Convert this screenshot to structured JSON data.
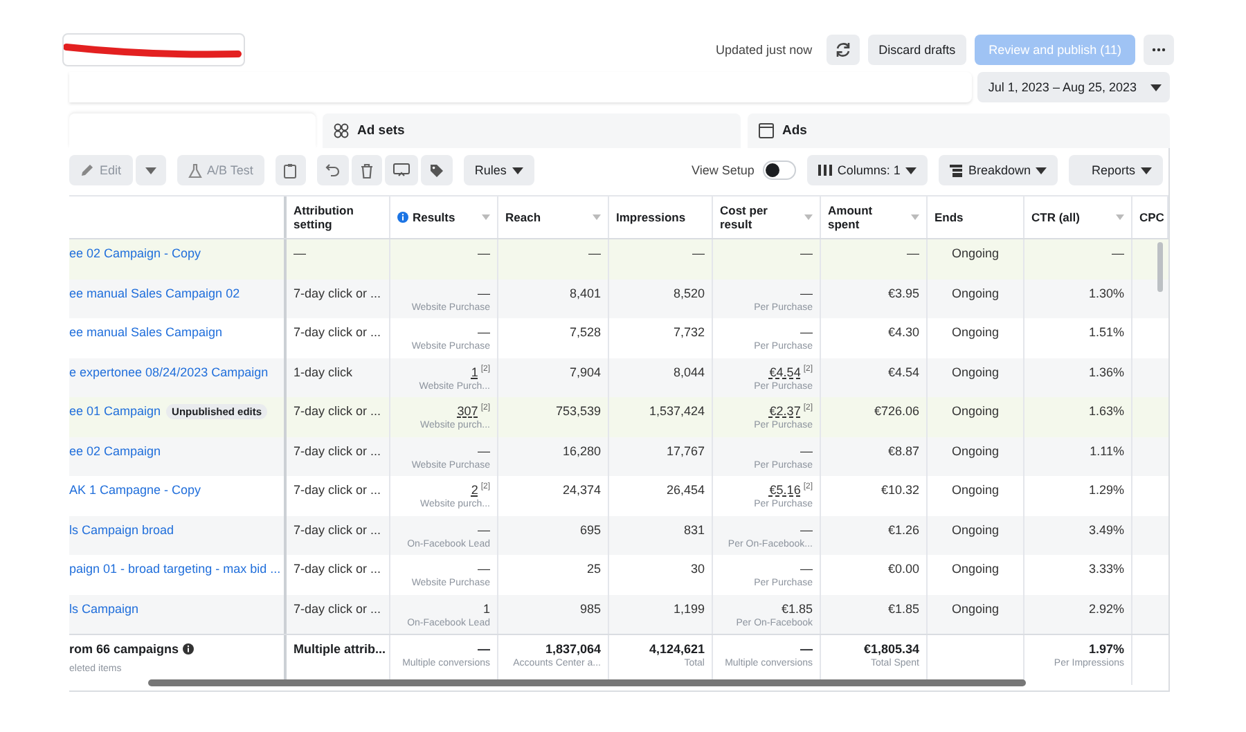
{
  "header": {
    "updated": "Updated just now",
    "discard": "Discard drafts",
    "publish": {
      "label": "Review and publish (11)",
      "disabled": true
    }
  },
  "date_range": "Jul 1, 2023 – Aug 25, 2023",
  "tabs": [
    {
      "selected": true
    },
    {
      "label": "Ad sets",
      "selected": false
    },
    {
      "label": "Ads",
      "selected": false
    }
  ],
  "toolbar": {
    "edit": {
      "label": "Edit",
      "disabled": true
    },
    "ab_test": {
      "label": "A/B Test",
      "disabled": true
    },
    "rules": "Rules",
    "view_setup": {
      "label": "View Setup",
      "on": false
    },
    "columns": "Columns: 1",
    "breakdown": "Breakdown",
    "reports": "Reports"
  },
  "columns": [
    {
      "label": "Attribution setting",
      "sortable": false,
      "info": false
    },
    {
      "label": "Results",
      "sortable": true,
      "info": true
    },
    {
      "label": "Reach",
      "sortable": true,
      "info": false
    },
    {
      "label": "Impressions",
      "sortable": false,
      "info": false
    },
    {
      "label": "Cost per result",
      "sortable": true,
      "info": false
    },
    {
      "label": "Amount spent",
      "sortable": true,
      "info": false
    },
    {
      "label": "Ends",
      "sortable": false,
      "info": false
    },
    {
      "label": "CTR (all)",
      "sortable": true,
      "info": false
    },
    {
      "label": "CPC"
    }
  ],
  "rows": [
    {
      "name": "ee 02 Campaign - Copy",
      "highlighted": true,
      "cells": [
        {
          "value": "—"
        },
        {
          "value": "—"
        },
        {
          "value": "—"
        },
        {
          "value": "—"
        },
        {
          "value": "—"
        },
        {
          "value": "—"
        },
        {
          "value": "Ongoing"
        },
        {
          "value": "—"
        }
      ]
    },
    {
      "name": "ee manual Sales Campaign 02",
      "highlighted": false,
      "cells": [
        {
          "value": "7-day click or ..."
        },
        {
          "value": "—",
          "sub": "Website Purchase"
        },
        {
          "value": "8,401"
        },
        {
          "value": "8,520"
        },
        {
          "value": "—",
          "sub": "Per Purchase"
        },
        {
          "value": "€3.95"
        },
        {
          "value": "Ongoing"
        },
        {
          "value": "1.30%"
        }
      ]
    },
    {
      "name": "ee manual Sales Campaign",
      "highlighted": false,
      "cells": [
        {
          "value": "7-day click or ..."
        },
        {
          "value": "—",
          "sub": "Website Purchase"
        },
        {
          "value": "7,528"
        },
        {
          "value": "7,732"
        },
        {
          "value": "—",
          "sub": "Per Purchase"
        },
        {
          "value": "€4.30"
        },
        {
          "value": "Ongoing"
        },
        {
          "value": "1.51%"
        }
      ]
    },
    {
      "name": "e expertonee 08/24/2023 Campaign",
      "highlighted": false,
      "cells": [
        {
          "value": "1-day click"
        },
        {
          "value": "1",
          "note": "[2]",
          "sub": "Website Purch..."
        },
        {
          "value": "7,904"
        },
        {
          "value": "8,044"
        },
        {
          "value": "€4.54",
          "note": "[2]",
          "sub": "Per Purchase"
        },
        {
          "value": "€4.54"
        },
        {
          "value": "Ongoing"
        },
        {
          "value": "1.36%"
        }
      ]
    },
    {
      "name": "ee 01 Campaign",
      "badge": "Unpublished edits",
      "highlighted": true,
      "cells": [
        {
          "value": "7-day click or ..."
        },
        {
          "value": "307",
          "note": "[2]",
          "sub": "Website purch..."
        },
        {
          "value": "753,539"
        },
        {
          "value": "1,537,424"
        },
        {
          "value": "€2.37",
          "note": "[2]",
          "sub": "Per Purchase"
        },
        {
          "value": "€726.06"
        },
        {
          "value": "Ongoing"
        },
        {
          "value": "1.63%"
        }
      ]
    },
    {
      "name": "ee 02 Campaign",
      "highlighted": false,
      "cells": [
        {
          "value": "7-day click or ..."
        },
        {
          "value": "—",
          "sub": "Website Purchase"
        },
        {
          "value": "16,280"
        },
        {
          "value": "17,767"
        },
        {
          "value": "—",
          "sub": "Per Purchase"
        },
        {
          "value": "€8.87"
        },
        {
          "value": "Ongoing"
        },
        {
          "value": "1.11%"
        }
      ]
    },
    {
      "name": "AK 1 Campagne - Copy",
      "highlighted": false,
      "cells": [
        {
          "value": "7-day click or ..."
        },
        {
          "value": "2",
          "note": "[2]",
          "sub": "Website purch..."
        },
        {
          "value": "24,374"
        },
        {
          "value": "26,454"
        },
        {
          "value": "€5.16",
          "note": "[2]",
          "sub": "Per Purchase"
        },
        {
          "value": "€10.32"
        },
        {
          "value": "Ongoing"
        },
        {
          "value": "1.29%"
        }
      ]
    },
    {
      "name": "ls Campaign broad",
      "highlighted": false,
      "cells": [
        {
          "value": "7-day click or ..."
        },
        {
          "value": "—",
          "sub": "On-Facebook Lead"
        },
        {
          "value": "695"
        },
        {
          "value": "831"
        },
        {
          "value": "—",
          "sub": "Per On-Facebook..."
        },
        {
          "value": "€1.26"
        },
        {
          "value": "Ongoing"
        },
        {
          "value": "3.49%"
        }
      ]
    },
    {
      "name": "paign 01 - broad targeting - max bid ...",
      "highlighted": false,
      "cells": [
        {
          "value": "7-day click or ..."
        },
        {
          "value": "—",
          "sub": "Website Purchase"
        },
        {
          "value": "25"
        },
        {
          "value": "30"
        },
        {
          "value": "—",
          "sub": "Per Purchase"
        },
        {
          "value": "€0.00"
        },
        {
          "value": "Ongoing"
        },
        {
          "value": "3.33%"
        }
      ]
    },
    {
      "name": "ls Campaign",
      "highlighted": false,
      "cells": [
        {
          "value": "7-day click or ..."
        },
        {
          "value": "1",
          "sub": "On-Facebook Lead"
        },
        {
          "value": "985"
        },
        {
          "value": "1,199"
        },
        {
          "value": "€1.85",
          "sub": "Per On-Facebook"
        },
        {
          "value": "€1.85"
        },
        {
          "value": "Ongoing"
        },
        {
          "value": "2.92%"
        }
      ]
    }
  ],
  "footer": {
    "name": "rom 66 campaigns",
    "sub": "eleted items",
    "cells": [
      {
        "value": "Multiple attrib..."
      },
      {
        "value": "—",
        "sub": "Multiple conversions"
      },
      {
        "value": "1,837,064",
        "sub": "Accounts Center a..."
      },
      {
        "value": "4,124,621",
        "sub": "Total"
      },
      {
        "value": "—",
        "sub": "Multiple conversions"
      },
      {
        "value": "€1,805.34",
        "sub": "Total Spent"
      },
      {},
      {
        "value": "1.97%",
        "sub": "Per Impressions"
      }
    ]
  }
}
